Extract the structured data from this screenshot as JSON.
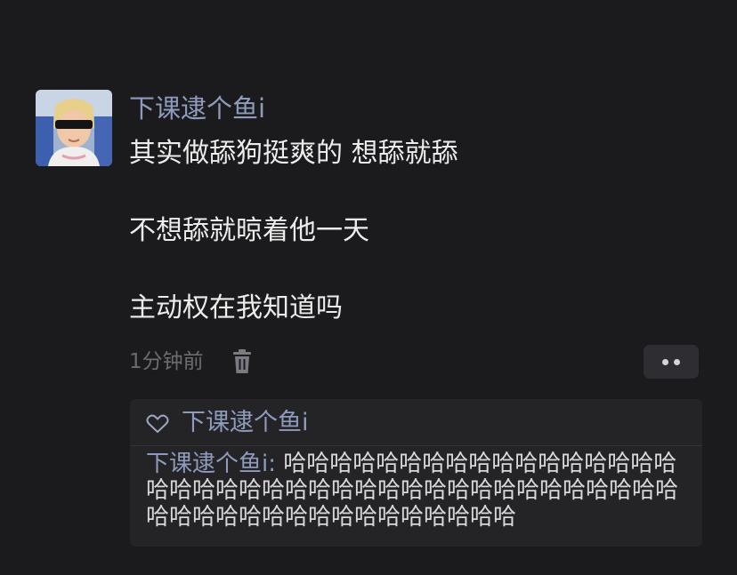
{
  "post": {
    "username": "下课逮个鱼i",
    "lines": [
      "其实做舔狗挺爽的 想舔就舔",
      "不想舔就晾着他一天",
      "主动权在我知道吗"
    ],
    "time": "1分钟前"
  },
  "likes": {
    "user": "下课逮个鱼i"
  },
  "comment": {
    "author": "下课逮个鱼i",
    "separator": ": ",
    "text": "哈哈哈哈哈哈哈哈哈哈哈哈哈哈哈哈哈哈哈哈哈哈哈哈哈哈哈哈哈哈哈哈哈哈哈哈哈哈哈哈哈哈哈哈哈哈哈哈哈哈哈哈哈哈哈哈"
  },
  "icons": {
    "delete": "trash-icon",
    "more": "more-dots-icon",
    "like": "heart-outline-icon"
  },
  "colors": {
    "background": "#1b1b1d",
    "username": "#8e9bbd",
    "text": "#ececec",
    "muted": "#6c6c70",
    "panel": "#242427"
  }
}
